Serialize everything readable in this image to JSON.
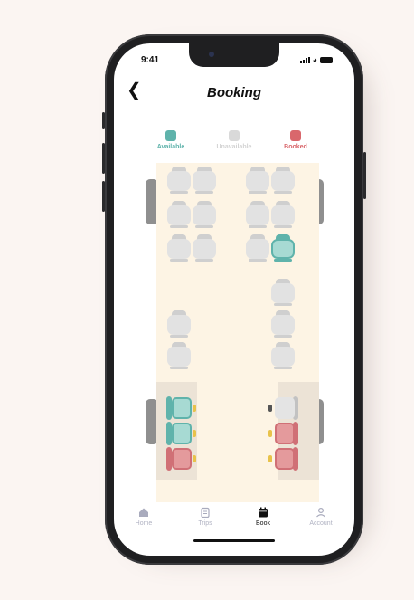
{
  "status_bar": {
    "time": "9:41"
  },
  "header": {
    "title": "Booking",
    "back_icon": "chevron-left-icon"
  },
  "legend": [
    {
      "label": "Available",
      "color": "#5fb3ab"
    },
    {
      "label": "Unavailable",
      "color": "#d9d9d9"
    },
    {
      "label": "Booked",
      "color": "#d9676c"
    }
  ],
  "seat_states": {
    "upper_left": [
      "unavailable",
      "unavailable",
      "unavailable",
      "unavailable",
      "unavailable",
      "unavailable"
    ],
    "upper_right": [
      "unavailable",
      "unavailable",
      "unavailable",
      "unavailable",
      "unavailable",
      "available"
    ],
    "middle_left": [
      "unavailable",
      "unavailable"
    ],
    "middle_right": [
      "unavailable",
      "unavailable",
      "unavailable"
    ],
    "sleeper_left": [
      "available",
      "available",
      "booked"
    ],
    "sleeper_right": [
      "unavailable",
      "booked",
      "booked"
    ]
  },
  "tabs": [
    {
      "label": "Home",
      "icon": "home-icon",
      "active": false
    },
    {
      "label": "Trips",
      "icon": "clipboard-icon",
      "active": false
    },
    {
      "label": "Book",
      "icon": "calendar-icon",
      "active": true
    },
    {
      "label": "Account",
      "icon": "user-icon",
      "active": false
    }
  ]
}
